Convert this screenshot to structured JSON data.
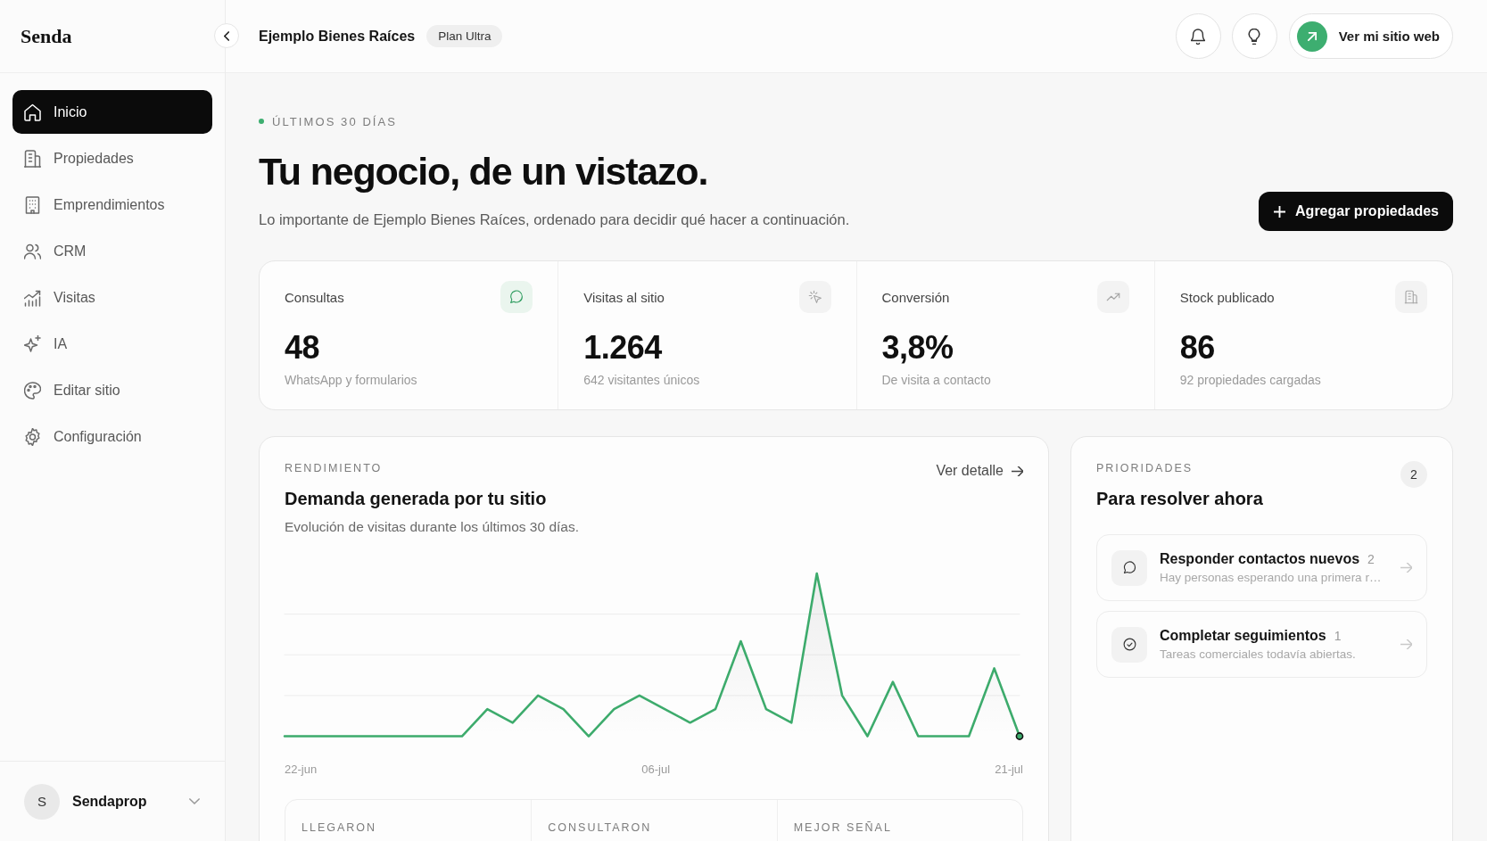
{
  "sidebar": {
    "logo": "Senda",
    "items": [
      {
        "label": "Inicio",
        "selected": true
      },
      {
        "label": "Propiedades",
        "selected": false
      },
      {
        "label": "Emprendimientos",
        "selected": false
      },
      {
        "label": "CRM",
        "selected": false
      },
      {
        "label": "Visitas",
        "selected": false
      },
      {
        "label": "IA",
        "selected": false
      },
      {
        "label": "Editar sitio",
        "selected": false
      },
      {
        "label": "Configuración",
        "selected": false
      }
    ],
    "account": {
      "initial": "S",
      "name": "Sendaprop"
    }
  },
  "header": {
    "title": "Ejemplo Bienes Raíces",
    "plan_badge": "Plan Ultra",
    "site_button": "Ver mi sitio web"
  },
  "hero": {
    "period": "ÚLTIMOS 30 DÍAS",
    "title": "Tu negocio, de un vistazo.",
    "subtitle": "Lo importante de Ejemplo Bienes Raíces, ordenado para decidir qué hacer a continuación.",
    "add_button": "Agregar propiedades"
  },
  "stats": [
    {
      "label": "Consultas",
      "value": "48",
      "note": "WhatsApp y formularios",
      "highlighted": true
    },
    {
      "label": "Visitas al sitio",
      "value": "1.264",
      "note": "642 visitantes únicos",
      "highlighted": false
    },
    {
      "label": "Conversión",
      "value": "3,8%",
      "note": "De visita a contacto",
      "highlighted": false
    },
    {
      "label": "Stock publicado",
      "value": "86",
      "note": "92 propiedades cargadas",
      "highlighted": false
    }
  ],
  "performance": {
    "eyebrow": "RENDIMIENTO",
    "title": "Demanda generada por tu sitio",
    "subtitle": "Evolución de visitas durante los últimos 30 días.",
    "link": "Ver detalle",
    "axis_labels": [
      "22-jun",
      "06-jul",
      "21-jul"
    ],
    "summary_columns": [
      "LLEGARON",
      "CONSULTARON",
      "MEJOR SEÑAL"
    ]
  },
  "priorities": {
    "eyebrow": "PRIORIDADES",
    "count": "2",
    "title": "Para resolver ahora",
    "items": [
      {
        "title": "Responder contactos nuevos",
        "count": "2",
        "description": "Hay personas esperando una primera r…"
      },
      {
        "title": "Completar seguimientos",
        "count": "1",
        "description": "Tareas comerciales todavía abiertas."
      }
    ]
  }
}
